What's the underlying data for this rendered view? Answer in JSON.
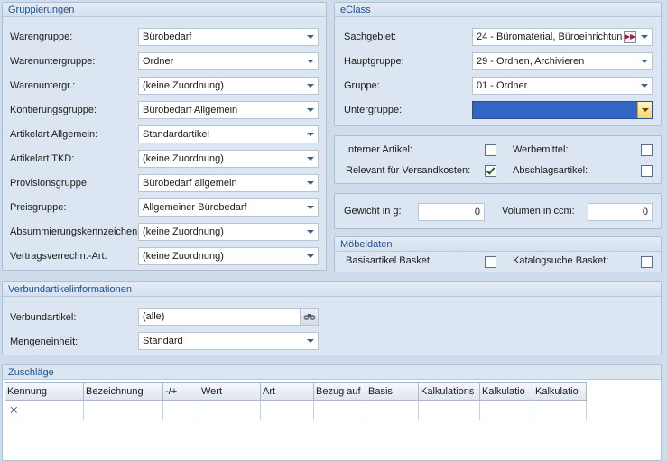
{
  "gruppierungen": {
    "title": "Gruppierungen",
    "fields": [
      {
        "label": "Warengruppe:",
        "value": "Bürobedarf"
      },
      {
        "label": "Warenuntergruppe:",
        "value": "Ordner"
      },
      {
        "label": "Warenuntergr.:",
        "value": "(keine Zuordnung)"
      },
      {
        "label": "Kontierungsgruppe:",
        "value": "Bürobedarf Allgemein"
      },
      {
        "label": "Artikelart Allgemein:",
        "value": "Standardartikel"
      },
      {
        "label": "Artikelart TKD:",
        "value": "(keine Zuordnung)"
      },
      {
        "label": "Provisionsgruppe:",
        "value": "Bürobedarf allgemein"
      },
      {
        "label": "Preisgruppe:",
        "value": "Allgemeiner Bürobedarf"
      },
      {
        "label": "Absummierungskennzeichen:",
        "value": "(keine Zuordnung)"
      },
      {
        "label": "Vertragsverrechn.-Art:",
        "value": "(keine Zuordnung)"
      }
    ]
  },
  "eclass": {
    "title": "eClass",
    "fields": [
      {
        "label": "Sachgebiet:",
        "value": "24 - Büromaterial, Büroeinrichtun"
      },
      {
        "label": "Hauptgruppe:",
        "value": "29 - Ordnen, Archivieren"
      },
      {
        "label": "Gruppe:",
        "value": "01 - Ordner"
      },
      {
        "label": "Untergruppe:",
        "value": ""
      }
    ]
  },
  "flags": {
    "interner_artikel": {
      "label": "Interner Artikel:",
      "checked": false
    },
    "werbemittel": {
      "label": "Werbemittel:",
      "checked": false
    },
    "relevant_versand": {
      "label": "Relevant für Versandkosten:",
      "checked": true
    },
    "abschlagsartikel": {
      "label": "Abschlagsartikel:",
      "checked": false
    }
  },
  "masse": {
    "gewicht_label": "Gewicht in g:",
    "gewicht_value": "0",
    "volumen_label": "Volumen in ccm:",
    "volumen_value": "0"
  },
  "moebeldaten": {
    "title": "Möbeldaten",
    "basisartikel": {
      "label": "Basisartikel Basket:",
      "checked": false
    },
    "katalogsuche": {
      "label": "Katalogsuche Basket:",
      "checked": false
    }
  },
  "verbund": {
    "title": "Verbundartikelinformationen",
    "artikel_label": "Verbundartikel:",
    "artikel_value": "(alle)",
    "einheit_label": "Mengeneinheit:",
    "einheit_value": "Standard"
  },
  "zuschlaege": {
    "title": "Zuschläge",
    "columns": [
      "Kennung",
      "Bezeichnung",
      "-/+",
      "Wert",
      "Art",
      "Bezug auf",
      "Basis",
      "Kalkulations",
      "Kalkulatio",
      "Kalkulatio"
    ],
    "new_row_marker": "✳"
  }
}
